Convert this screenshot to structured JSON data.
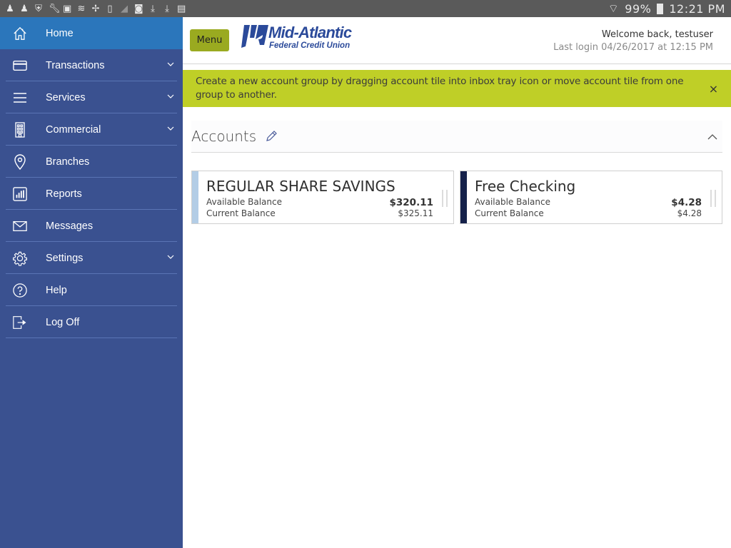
{
  "statusbar": {
    "left_icons": [
      "notification-icon",
      "notification-icon",
      "shield-icon",
      "wrench-icon",
      "image-icon",
      "signal-icon",
      "fan-icon",
      "phone-clock-icon",
      "chart-icon",
      "camera-icon",
      "download-icon",
      "download-icon",
      "sd-card-icon"
    ],
    "battery": "99%",
    "time": "12:21 PM"
  },
  "sidebar": {
    "items": [
      {
        "label": "Home",
        "icon": "home-icon",
        "active": true,
        "expandable": false
      },
      {
        "label": "Transactions",
        "icon": "credit-card-icon",
        "active": false,
        "expandable": true
      },
      {
        "label": "Services",
        "icon": "list-icon",
        "active": false,
        "expandable": true
      },
      {
        "label": "Commercial",
        "icon": "building-icon",
        "active": false,
        "expandable": true
      },
      {
        "label": "Branches",
        "icon": "location-pin-icon",
        "active": false,
        "expandable": false
      },
      {
        "label": "Reports",
        "icon": "bar-chart-icon",
        "active": false,
        "expandable": false
      },
      {
        "label": "Messages",
        "icon": "envelope-icon",
        "active": false,
        "expandable": false
      },
      {
        "label": "Settings",
        "icon": "gear-icon",
        "active": false,
        "expandable": true
      },
      {
        "label": "Help",
        "icon": "question-icon",
        "active": false,
        "expandable": false
      },
      {
        "label": "Log Off",
        "icon": "logout-icon",
        "active": false,
        "expandable": false
      }
    ]
  },
  "header": {
    "menu_label": "Menu",
    "logo_brand": "Mid-Atlantic",
    "logo_sub": "Federal Credit Union",
    "welcome": "Welcome back, testuser",
    "last_login": "Last login 04/26/2017 at 12:15 PM"
  },
  "banner": {
    "text": "Create a new account group by dragging account tile into inbox tray icon or move account tile from one group to another.",
    "close": "×"
  },
  "accounts": {
    "title": "Accounts",
    "tiles": [
      {
        "name": "REGULAR SHARE SAVINGS",
        "available_label": "Available Balance",
        "available": "$320.11",
        "current_label": "Current Balance",
        "current": "$325.11",
        "color": "#b3cde6"
      },
      {
        "name": "Free Checking",
        "available_label": "Available Balance",
        "available": "$4.28",
        "current_label": "Current Balance",
        "current": "$4.28",
        "color": "#15214a"
      }
    ]
  },
  "colors": {
    "sidebar": "#3a5190",
    "sidebar_active": "#2b76bb",
    "menu_button": "#9aaa20",
    "banner": "#bfcf27",
    "brand": "#2b4a9a"
  }
}
